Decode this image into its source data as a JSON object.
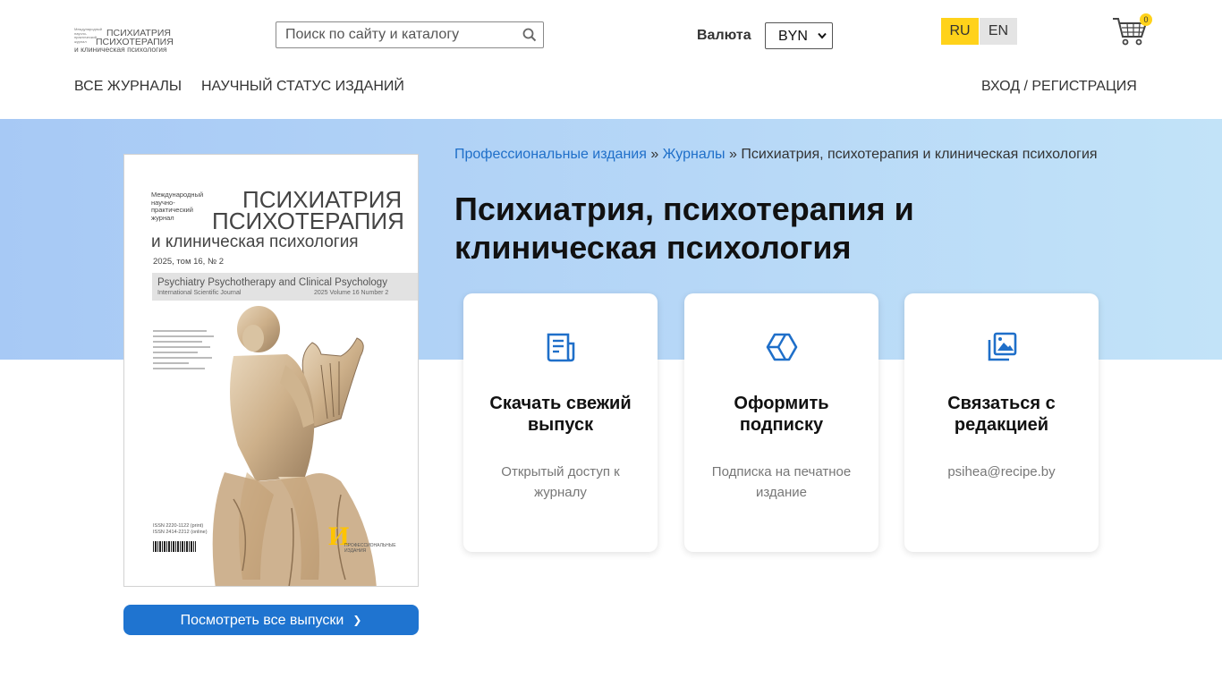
{
  "header": {
    "logo": {
      "tiny": "Международный научно-практический журнал",
      "line1": "ПСИХИАТРИЯ",
      "line2": "ПСИХОТЕРАПИЯ",
      "line3": "и клиническая психология"
    },
    "search": {
      "placeholder": "Поиск по сайту и каталогу",
      "icon": "search-icon"
    },
    "currency": {
      "label": "Валюта",
      "selected": "BYN"
    },
    "languages": [
      {
        "code": "RU",
        "active": true
      },
      {
        "code": "EN",
        "active": false
      }
    ],
    "cart": {
      "count": "0",
      "icon": "cart-icon"
    }
  },
  "nav": {
    "items": [
      "ВСЕ ЖУРНАЛЫ",
      "НАУЧНЫЙ СТАТУС ИЗДАНИЙ"
    ],
    "login": "ВХОД / РЕГИСТРАЦИЯ"
  },
  "cover": {
    "intl": "Международный научно-практический журнал",
    "title1": "ПСИХИАТРИЯ",
    "title2": "ПСИХОТЕРАПИЯ",
    "title3": "и клиническая психология",
    "issue": "2025, том 16, № 2",
    "en_title": "Psychiatry Psychotherapy and Clinical Psychology",
    "en_sub": "International Scientific Journal",
    "en_issue": "2025  Volume 16  Number 2",
    "issn": "ISSN 2220-1122 (print)\nISSN 2414-2212 (online)",
    "publisher_mark": "И",
    "publisher_name": "ПРОФЕССИОНАЛЬНЫЕ ИЗДАНИЯ"
  },
  "all_issues_button": "Посмотреть все выпуски",
  "breadcrumb": {
    "link1": "Профессиональные издания",
    "sep": " » ",
    "link2": "Журналы",
    "current": "Психиатрия, психотерапия и клиническая психология"
  },
  "page_title": "Психиатрия, психотерапия и клиническая психология",
  "cards": [
    {
      "icon": "newspaper-icon",
      "title": "Скачать свежий выпуск",
      "subtitle": "Открытый доступ к журналу"
    },
    {
      "icon": "box-icon",
      "title": "Оформить подписку",
      "subtitle": "Подписка на печатное издание"
    },
    {
      "icon": "image-gallery-icon",
      "title": "Связаться с редакцией",
      "subtitle": "psihea@recipe.by"
    }
  ],
  "colors": {
    "accent": "#1f74d0",
    "lang_active": "#ffd21a",
    "hero": "#b7d8f7"
  }
}
